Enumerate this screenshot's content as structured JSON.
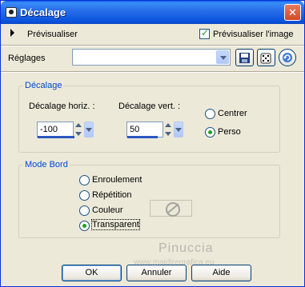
{
  "window": {
    "title": "Décalage",
    "icons": {
      "app": "app-icon",
      "close": "close-icon"
    }
  },
  "toolbar": {
    "preview_label": "Prévisualiser",
    "preview_image_label": "Prévisualiser l'image",
    "preview_image_checked": true
  },
  "settings": {
    "label": "Réglages",
    "preset_value": "",
    "icons": [
      "save-icon",
      "random-dice-icon",
      "reset-icon"
    ]
  },
  "offset_group": {
    "title": "Décalage",
    "horiz_label": "Décalage horiz. :",
    "horiz_value": "-100",
    "vert_label": "Décalage vert. :",
    "vert_value": "50",
    "options": [
      "Centrer",
      "Perso"
    ],
    "selected": "Perso"
  },
  "edge_group": {
    "title": "Mode Bord",
    "options": [
      "Enroulement",
      "Répétition",
      "Couleur",
      "Transparent"
    ],
    "selected": "Transparent"
  },
  "watermark": {
    "name": "Pinuccia",
    "url": "www.maidiregrafica.eu"
  },
  "buttons": {
    "ok": "OK",
    "cancel": "Annuler",
    "help": "Aide"
  },
  "colors": {
    "accent": "#0046d5",
    "title_bar": "#0a53dc",
    "check_mark": "#21a121"
  }
}
